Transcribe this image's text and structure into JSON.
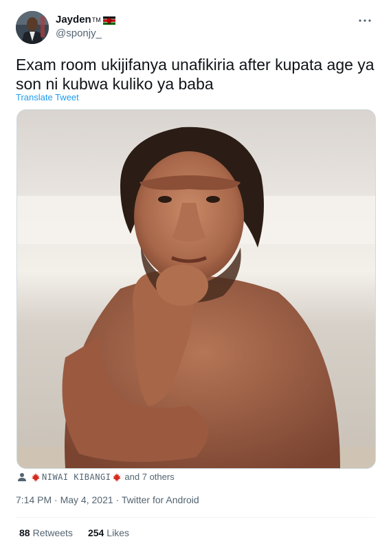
{
  "author": {
    "display_name": "Jayden",
    "tm": "TM",
    "flag_icon": "kenya-flag-icon",
    "handle": "@sponjy_"
  },
  "tweet": {
    "text": "Exam room ukijifanya unafikiria after kupata age ya son ni kubwa kuliko ya baba",
    "translate_label": "Translate Tweet"
  },
  "tagged": {
    "name": "NIWAI KIBANGI",
    "others": "and 7 others",
    "flag_icon": "canada-maple-leaf-icon"
  },
  "meta": {
    "time": "7:14 PM",
    "separator": " · ",
    "date": "May 4, 2021",
    "source": "Twitter for Android"
  },
  "stats": {
    "retweets_count": "88",
    "retweets_label": "Retweets",
    "likes_count": "254",
    "likes_label": "Likes"
  },
  "colors": {
    "text_primary": "#0f1419",
    "text_secondary": "#536471",
    "link": "#1d9bf0",
    "border": "#cfd9de"
  }
}
